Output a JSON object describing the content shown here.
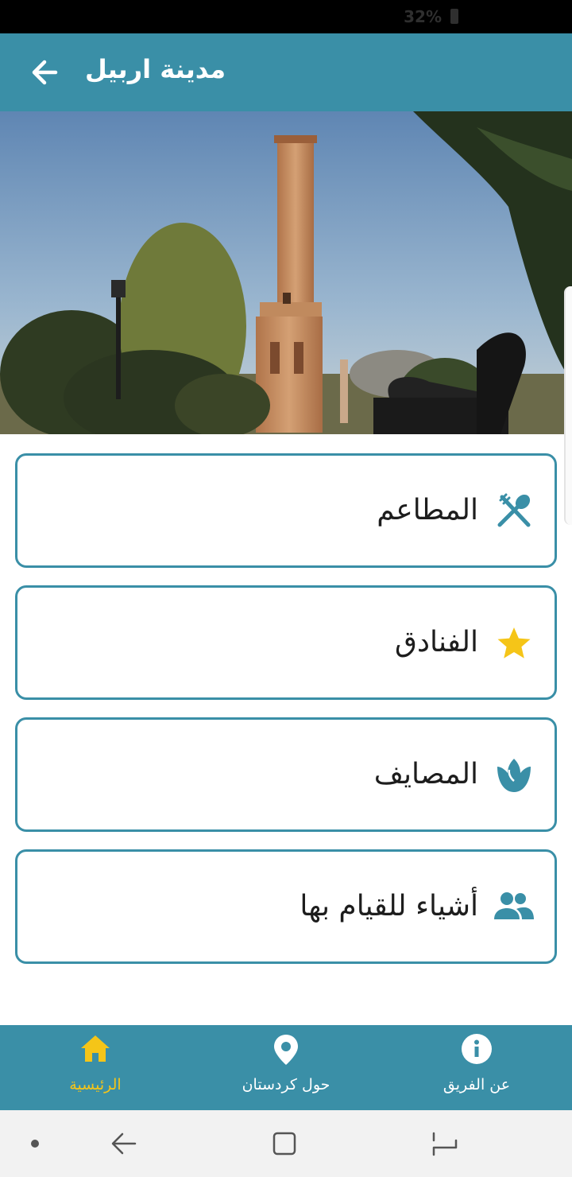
{
  "status_bar": {
    "battery": "32%"
  },
  "app_bar": {
    "title": "مدينة اربيل",
    "back_icon": "arrow-left-icon"
  },
  "hero": {
    "icon": "minaret-photo"
  },
  "menu": [
    {
      "label": "المطاعم",
      "icon": "fork-spoon-icon"
    },
    {
      "label": "الفنادق",
      "icon": "star-icon"
    },
    {
      "label": "المصايف",
      "icon": "tulip-icon"
    },
    {
      "label": "أشياء للقيام بها",
      "icon": "people-icon"
    }
  ],
  "bottom_nav": {
    "items": [
      {
        "label": "الرئيسية",
        "icon": "home-icon",
        "active": true
      },
      {
        "label": "حول كردستان",
        "icon": "location-pin-icon",
        "active": false
      },
      {
        "label": "عن الفريق",
        "icon": "info-icon",
        "active": false
      }
    ]
  },
  "colors": {
    "primary": "#3a8fa7",
    "accent": "#f5c518"
  }
}
